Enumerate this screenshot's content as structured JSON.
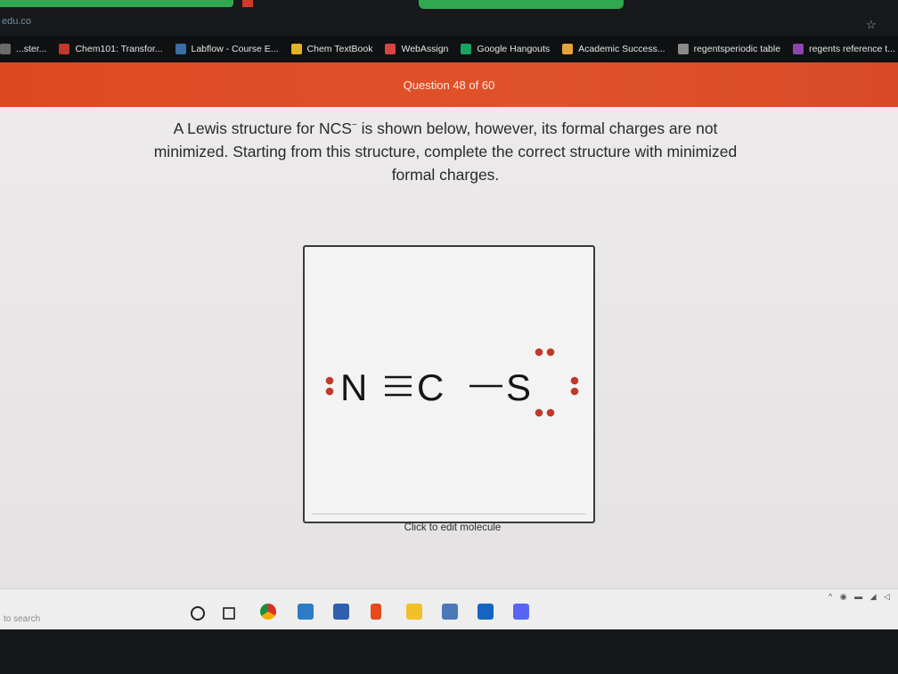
{
  "browser": {
    "url_fragment": "edu.co",
    "bookmarks": [
      {
        "label": "...ster...",
        "icon": "bookmark-icon",
        "color": "#6b6b6b"
      },
      {
        "label": "Chem101: Transfor...",
        "icon": "chem101-icon",
        "color": "#c0392b"
      },
      {
        "label": "Labflow - Course E...",
        "icon": "labflow-icon",
        "color": "#3b6ea5"
      },
      {
        "label": "Chem TextBook",
        "icon": "textbook-icon",
        "color": "#e4b323"
      },
      {
        "label": "WebAssign",
        "icon": "webassign-icon",
        "color": "#d64541"
      },
      {
        "label": "Google Hangouts",
        "icon": "hangouts-icon",
        "color": "#1aa260"
      },
      {
        "label": "Academic Success...",
        "icon": "academic-icon",
        "color": "#e6a23c"
      },
      {
        "label": "regentsperiodic table",
        "icon": "globe-icon",
        "color": "#8a8a8a"
      },
      {
        "label": "regents reference t...",
        "icon": "reference-icon",
        "color": "#8e44ad"
      }
    ]
  },
  "question": {
    "header": "Question 48 of 60",
    "prompt_before": "A Lewis structure for NCS",
    "prompt_charge": "−",
    "prompt_after": " is shown below, however, its formal charges are not minimized. Starting from this structure, complete the correct structure with minimized formal charges."
  },
  "molecule": {
    "atoms": [
      "N",
      "C",
      "S"
    ],
    "bonds": [
      "≡",
      "−"
    ],
    "lone_pair_color": "#c0392b",
    "caption": "Click to edit molecule"
  },
  "taskbar": {
    "search_text": "to search"
  }
}
